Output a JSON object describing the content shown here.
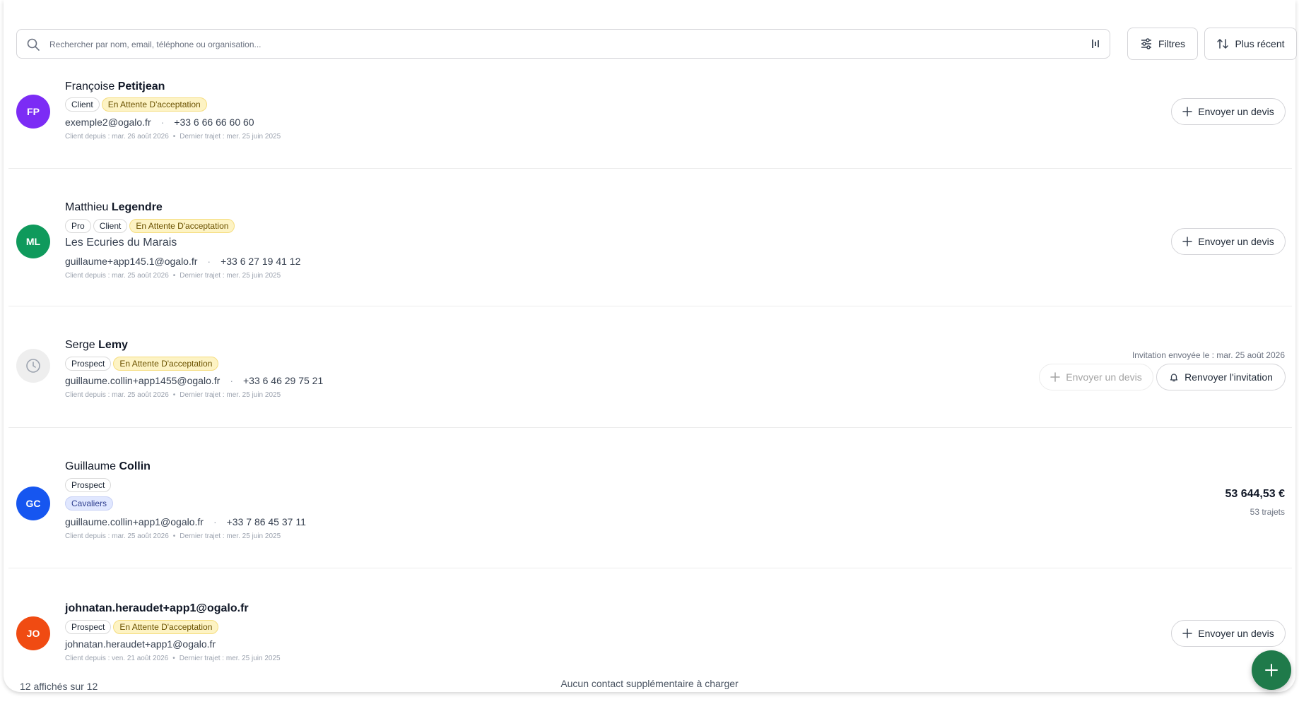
{
  "search": {
    "placeholder": "Rechercher par nom, email, téléphone ou organisation..."
  },
  "toolbar": {
    "filters_label": "Filtres",
    "sort_label": "Plus récent"
  },
  "contacts": [
    {
      "initials": "FP",
      "avatar_color": "#7c2cf5",
      "first_name": "Françoise ",
      "last_name": "Petitjean",
      "tags": [
        "Client",
        "En Attente D'acceptation"
      ],
      "email": "exemple2@ogalo.fr",
      "phone": "+33 6 66 66 60 60",
      "client_since": "Client depuis : mar. 26 août 2026",
      "last_trip": "Dernier trajet : mer. 25 juin 2025",
      "action_label": "Envoyer un devis"
    },
    {
      "initials": "ML",
      "avatar_color": "#0f9a5c",
      "first_name": "Matthieu ",
      "last_name": "Legendre",
      "tags": [
        "Pro",
        "Client",
        "En Attente D'acceptation"
      ],
      "organization": "Les Ecuries du Marais",
      "email": "guillaume+app145.1@ogalo.fr",
      "phone": "+33 6 27 19 41 12",
      "client_since": "Client depuis : mar. 25 août 2026",
      "last_trip": "Dernier trajet : mer. 25 juin 2025",
      "action_label": "Envoyer un devis"
    },
    {
      "initials": "",
      "avatar_color": "#eeeeee",
      "first_name": "Serge ",
      "last_name": "Lemy",
      "tags": [
        "Prospect",
        "En Attente D'acceptation"
      ],
      "email": "guillaume.collin+app1455@ogalo.fr",
      "phone": "+33 6 46 29 75 21",
      "client_since": "Client depuis : mar. 25 août 2026",
      "last_trip": "Dernier trajet : mer. 25 juin 2025",
      "invite_note": "Invitation envoyée le : mar. 25 août 2026",
      "action_label": "Envoyer un devis",
      "resend_label": "Renvoyer l'invitation"
    },
    {
      "initials": "GC",
      "avatar_color": "#1656f0",
      "first_name": "Guillaume ",
      "last_name": "Collin",
      "tags": [
        "Prospect"
      ],
      "group_tag": "Cavaliers",
      "email": "guillaume.collin+app1@ogalo.fr",
      "phone": "+33 7 86 45 37 11",
      "client_since": "Client depuis : mar. 25 août 2026",
      "last_trip": "Dernier trajet : mer. 25 juin 2025",
      "amount": "53 644,53 €",
      "trips": "53 trajets"
    },
    {
      "initials": "JO",
      "avatar_color": "#f04b12",
      "name": "johnatan.heraudet+app1@ogalo.fr",
      "tags": [
        "Prospect",
        "En Attente D'acceptation"
      ],
      "email": "johnatan.heraudet+app1@ogalo.fr",
      "client_since": "Client depuis : ven. 21 août 2026",
      "last_trip": "Dernier trajet : mer. 25 juin 2025",
      "action_label": "Envoyer un devis"
    }
  ],
  "footer": {
    "count": "12 affichés sur 12",
    "message": "Aucun contact supplémentaire à charger"
  }
}
